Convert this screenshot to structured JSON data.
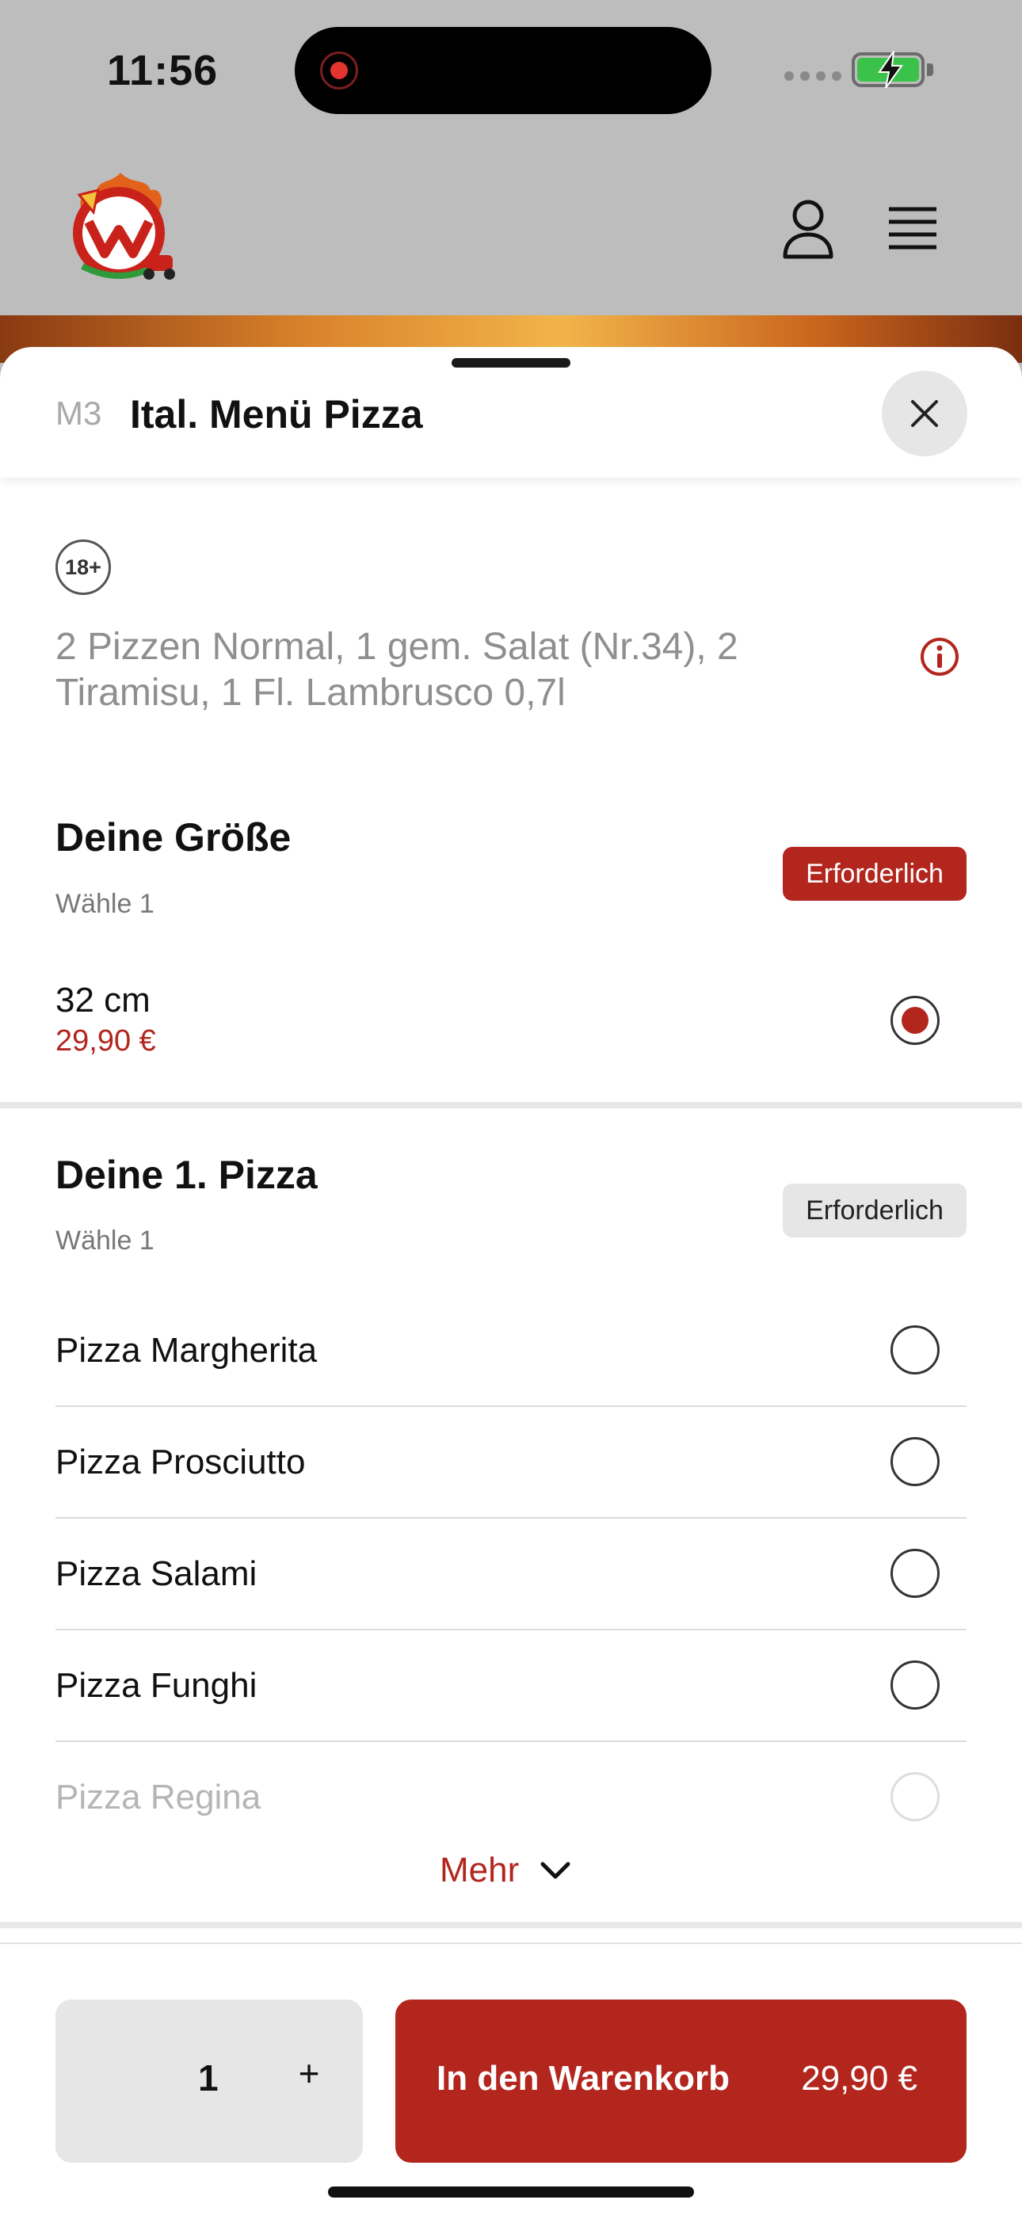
{
  "status_bar": {
    "time": "11:56"
  },
  "colors": {
    "brand_red": "#b3261e",
    "battery_green": "#3bc24a"
  },
  "icons": [
    "record-icon",
    "signal-icon",
    "battery-icon",
    "logo",
    "user-icon",
    "menu-icon",
    "close-icon",
    "info-icon",
    "chevron-down-icon"
  ],
  "sheet": {
    "code": "M3",
    "title": "Ital. Menü Pizza",
    "age_badge": "18+",
    "description": "2 Pizzen Normal, 1 gem. Salat (Nr.34), 2 Tiramisu, 1 Fl. Lambrusco 0,7l"
  },
  "size_section": {
    "title": "Deine Größe",
    "subtitle": "Wähle 1",
    "badge": "Erforderlich",
    "option": {
      "name": "32 cm",
      "price": "29,90 €",
      "selected": true
    }
  },
  "pizza_section": {
    "title": "Deine 1. Pizza",
    "subtitle": "Wähle 1",
    "badge": "Erforderlich",
    "options": [
      "Pizza Margherita",
      "Pizza Prosciutto",
      "Pizza Salami",
      "Pizza Funghi",
      "Pizza Regina"
    ],
    "more_label": "Mehr"
  },
  "footer": {
    "quantity": "1",
    "plus_label": "+",
    "cart_label": "In den Warenkorb",
    "cart_price": "29,90 €"
  }
}
